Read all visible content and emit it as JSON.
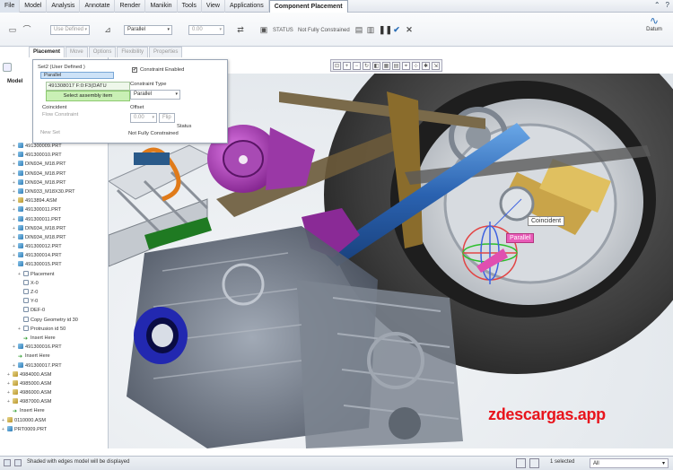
{
  "menu": [
    "File",
    "Model",
    "Analysis",
    "Annotate",
    "Render",
    "Manikin",
    "Tools",
    "View",
    "Applications",
    "Component Placement"
  ],
  "ribbon": {
    "user_defined": "Use Defined",
    "constraint": "Parallel",
    "offset": "0.00",
    "status_label": "STATUS",
    "status_value": "Not Fully Constrained",
    "datum": "Datum"
  },
  "tabs": [
    "Placement",
    "Move",
    "Options",
    "Flexibility",
    "Properties"
  ],
  "left_panel": {
    "model_label": "Model"
  },
  "popup": {
    "set_label": "Set2 (User Defined )",
    "selected_item": "Parallel",
    "reference": "491308017 F:0:F3(DATU",
    "select_prompt": "Select assembly item",
    "coincident": "Coincident",
    "flow_constraint": "Flow Constraint",
    "new_set": "New Set",
    "constraint_enabled": "Constraint Enabled",
    "constraint_type_label": "Constraint Type",
    "constraint_type_value": "Parallel",
    "offset_label": "Offset",
    "offset_value": "0.00",
    "flip": "Flip",
    "status_heading": "Status",
    "status_value": "Not Fully Constrained"
  },
  "tree": [
    {
      "label": "491300009.PRT",
      "type": "prt",
      "indent": 0,
      "twisty": "+"
    },
    {
      "label": "491300010.PRT",
      "type": "prt",
      "indent": 0,
      "twisty": "+"
    },
    {
      "label": "DIN934_M18.PRT",
      "type": "prt",
      "indent": 0,
      "twisty": "+"
    },
    {
      "label": "DIN934_M18.PRT",
      "type": "prt",
      "indent": 0,
      "twisty": "+"
    },
    {
      "label": "DIN934_M18.PRT",
      "type": "prt",
      "indent": 0,
      "twisty": "+"
    },
    {
      "label": "DIN933_M18X30.PRT",
      "type": "prt",
      "indent": 0,
      "twisty": "+"
    },
    {
      "label": "4913894.ASM",
      "type": "asm",
      "indent": 0,
      "twisty": "+"
    },
    {
      "label": "491300011.PRT",
      "type": "prt",
      "indent": 0,
      "twisty": "+"
    },
    {
      "label": "491300011.PRT",
      "type": "prt",
      "indent": 0,
      "twisty": "+"
    },
    {
      "label": "DIN934_M18.PRT",
      "type": "prt",
      "indent": 0,
      "twisty": "+"
    },
    {
      "label": "DIN934_M18.PRT",
      "type": "prt",
      "indent": 0,
      "twisty": "+"
    },
    {
      "label": "491300012.PRT",
      "type": "prt",
      "indent": 0,
      "twisty": "+"
    },
    {
      "label": "491300014.PRT",
      "type": "prt",
      "indent": 0,
      "twisty": "+"
    },
    {
      "label": "491300015.PRT",
      "type": "prt",
      "indent": 0,
      "twisty": "-"
    },
    {
      "label": "Placement",
      "type": "feat",
      "indent": 1,
      "twisty": "+"
    },
    {
      "label": "X-0",
      "type": "feat",
      "indent": 1,
      "twisty": ""
    },
    {
      "label": "Z-0",
      "type": "feat",
      "indent": 1,
      "twisty": ""
    },
    {
      "label": "Y-0",
      "type": "feat",
      "indent": 1,
      "twisty": ""
    },
    {
      "label": "DEF-0",
      "type": "feat",
      "indent": 1,
      "twisty": ""
    },
    {
      "label": "Copy Geometry id 30",
      "type": "feat",
      "indent": 1,
      "twisty": ""
    },
    {
      "label": "Protrusion id 50",
      "type": "feat",
      "indent": 1,
      "twisty": "+"
    },
    {
      "label": "Insert Here",
      "type": "ins",
      "indent": 1,
      "twisty": ""
    },
    {
      "label": "491300016.PRT",
      "type": "prt",
      "indent": 0,
      "twisty": "+"
    },
    {
      "label": "Insert Here",
      "type": "ins",
      "indent": 0,
      "twisty": ""
    },
    {
      "label": "491300017.PRT",
      "type": "prt",
      "indent": 0,
      "twisty": "+"
    },
    {
      "label": "4984000.ASM",
      "type": "asm",
      "indent": -1,
      "twisty": "+"
    },
    {
      "label": "4985000.ASM",
      "type": "asm",
      "indent": -1,
      "twisty": "+"
    },
    {
      "label": "4986000.ASM",
      "type": "asm",
      "indent": -1,
      "twisty": "+"
    },
    {
      "label": "4987000.ASM",
      "type": "asm",
      "indent": -1,
      "twisty": "+"
    },
    {
      "label": "Insert Here",
      "type": "ins",
      "indent": -1,
      "twisty": ""
    },
    {
      "label": "0110000.ASM",
      "type": "asm",
      "indent": -2,
      "twisty": "+"
    },
    {
      "label": "PRT0009.PRT",
      "type": "prt",
      "indent": -2,
      "twisty": "+"
    }
  ],
  "viewport": {
    "label_coincident": "Coincident",
    "label_parallel": "Parallel",
    "watermark": "zdescargas.app"
  },
  "status_bar": {
    "message": "Shaded with edges model will be displayed",
    "selected": "1 selected",
    "filter": "All"
  },
  "colors": {
    "accent": "#2c6fb7",
    "watermark": "#e8141c",
    "select_green": "#c9f0b5"
  }
}
